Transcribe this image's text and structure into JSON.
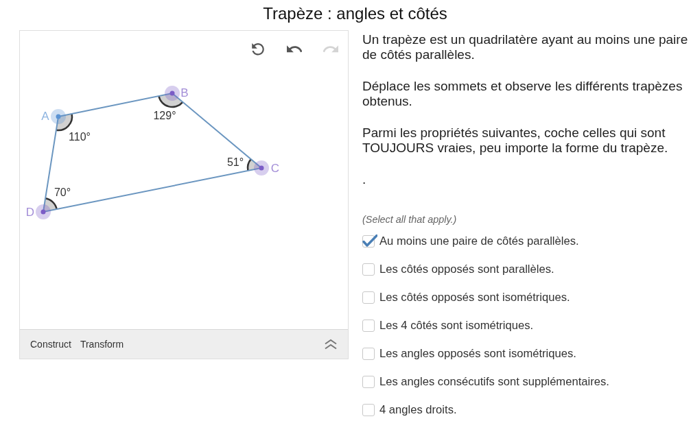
{
  "title": "Trapèze : angles et côtés",
  "applet": {
    "toolbar": [
      {
        "kind": "reset",
        "disabled": false
      },
      {
        "kind": "undo",
        "disabled": false
      },
      {
        "kind": "redo",
        "disabled": true
      }
    ],
    "points": [
      {
        "label": "A",
        "angle": "110°",
        "color": "#5b93d3"
      },
      {
        "label": "B",
        "angle": "129°",
        "color": "#7b5cc6"
      },
      {
        "label": "C",
        "angle": "51°",
        "color": "#7b5cc6"
      },
      {
        "label": "D",
        "angle": "70°",
        "color": "#7b5cc6"
      }
    ],
    "menu_tabs": [
      "Construct",
      "Transform"
    ],
    "expanded": false
  },
  "paragraphs": [
    "Un trapèze est un quadrilatère ayant au moins une paire de côtés parallèles.",
    "Déplace les sommets et observe les différents trapèzes obtenus.",
    "Parmi les propriétés suivantes, coche celles qui sont TOUJOURS vraies, peu importe la forme du trapèze.",
    "."
  ],
  "hint": "(Select all that apply.)",
  "options": [
    {
      "label": "Au moins une paire de côtés parallèles.",
      "checked": true
    },
    {
      "label": "Les côtés opposés sont parallèles.",
      "checked": false
    },
    {
      "label": "Les côtés opposés sont isométriques.",
      "checked": false
    },
    {
      "label": "Les 4 côtés sont isométriques.",
      "checked": false
    },
    {
      "label": "Les angles opposés sont isométriques.",
      "checked": false
    },
    {
      "label": "Les angles consécutifs sont supplémentaires.",
      "checked": false
    },
    {
      "label": "4 angles droits.",
      "checked": false
    }
  ]
}
